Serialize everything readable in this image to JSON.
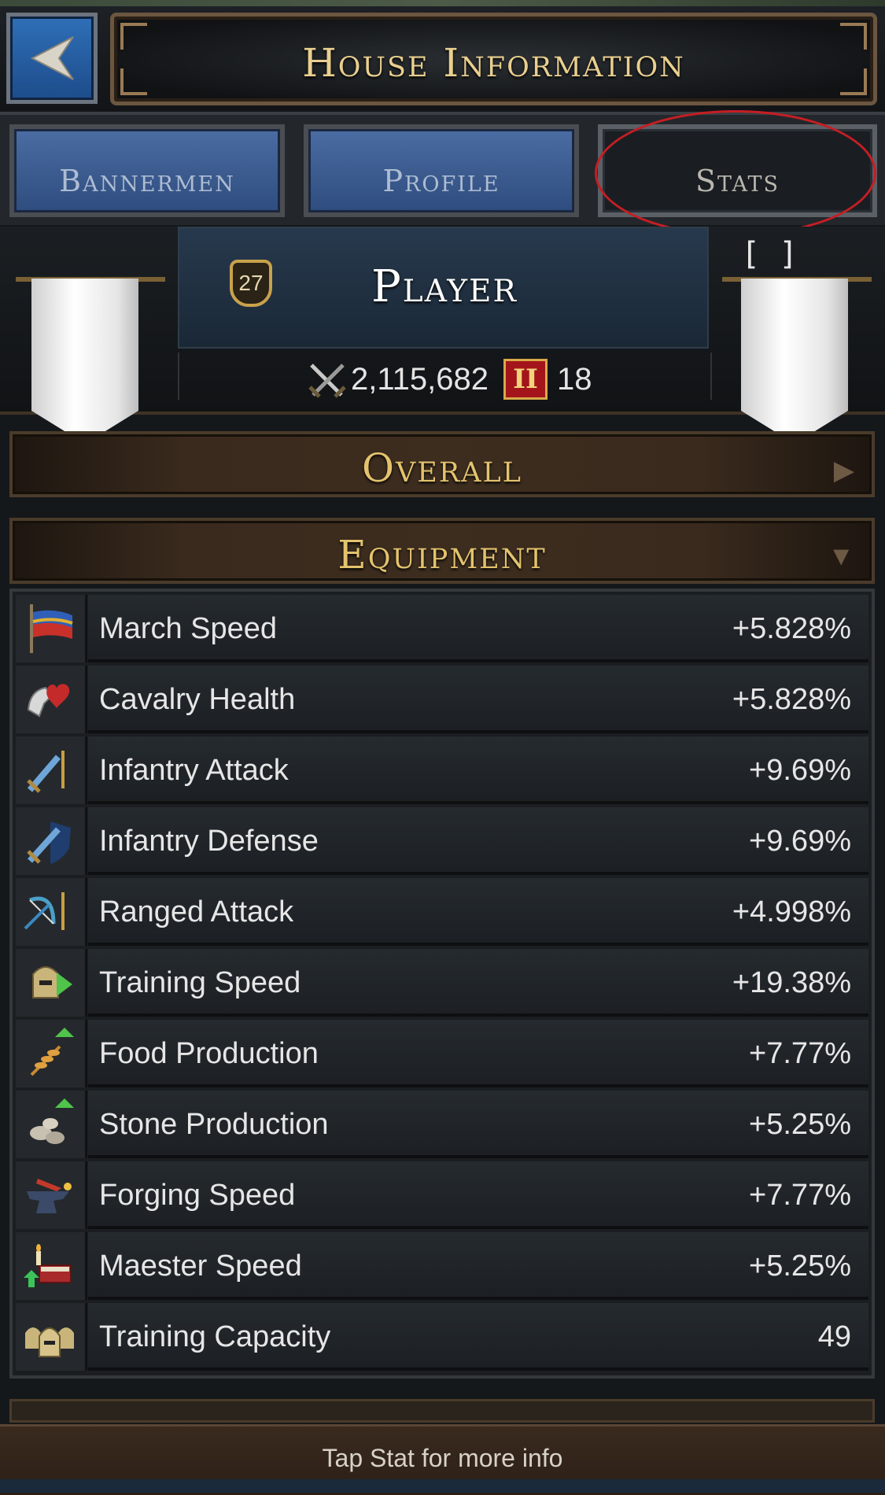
{
  "header": {
    "title": "House Information"
  },
  "tabs": [
    {
      "label": "Bannermen",
      "selected": false
    },
    {
      "label": "Profile",
      "selected": false
    },
    {
      "label": "Stats",
      "selected": true
    }
  ],
  "player": {
    "level": "27",
    "name": "Player",
    "power": "2,115,682",
    "rank_badge": "II",
    "rank_value": "18",
    "bracket_text": "[    ]"
  },
  "sections": {
    "overall": "Overall",
    "equipment": "Equipment"
  },
  "stats": [
    {
      "label": "March Speed",
      "value": "+5.828%",
      "icon": "march-speed-icon"
    },
    {
      "label": "Cavalry Health",
      "value": "+5.828%",
      "icon": "cavalry-health-icon"
    },
    {
      "label": "Infantry Attack",
      "value": "+9.69%",
      "icon": "infantry-attack-icon"
    },
    {
      "label": "Infantry Defense",
      "value": "+9.69%",
      "icon": "infantry-defense-icon"
    },
    {
      "label": "Ranged Attack",
      "value": "+4.998%",
      "icon": "ranged-attack-icon"
    },
    {
      "label": "Training Speed",
      "value": "+19.38%",
      "icon": "training-speed-icon"
    },
    {
      "label": "Food Production",
      "value": "+7.77%",
      "icon": "food-production-icon"
    },
    {
      "label": "Stone Production",
      "value": "+5.25%",
      "icon": "stone-production-icon"
    },
    {
      "label": "Forging Speed",
      "value": "+7.77%",
      "icon": "forging-speed-icon"
    },
    {
      "label": "Maester Speed",
      "value": "+5.25%",
      "icon": "maester-speed-icon"
    },
    {
      "label": "Training Capacity",
      "value": "49",
      "icon": "training-capacity-icon"
    }
  ],
  "footer": {
    "hint": "Tap Stat for more info"
  },
  "colors": {
    "accent_gold": "#e3c36d",
    "tab_blue": "#3d5c90",
    "highlight_red": "#c51e24"
  }
}
